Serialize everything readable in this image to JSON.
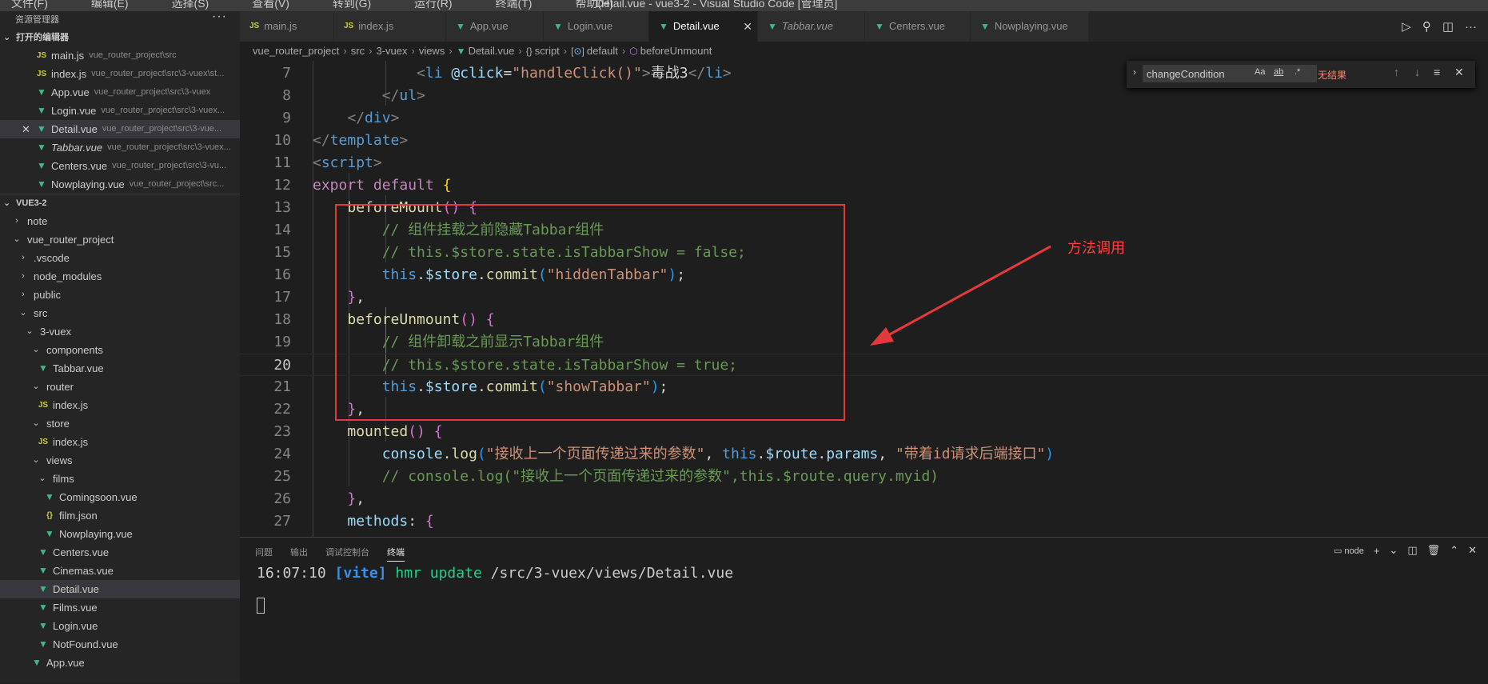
{
  "titlebar": {
    "menus": [
      "文件(F)",
      "编辑(E)",
      "选择(S)",
      "查看(V)",
      "转到(G)",
      "运行(R)",
      "终端(T)",
      "帮助(H)"
    ],
    "window_title": "Detail.vue - vue3-2 - Visual Studio Code [管理员]"
  },
  "sidebar": {
    "header": "资源管理器",
    "more": "···",
    "open_editors_title": "打开的编辑器",
    "open_editors": [
      {
        "icon": "JS",
        "name": "main.js",
        "path": "vue_router_project\\src"
      },
      {
        "icon": "JS",
        "name": "index.js",
        "path": "vue_router_project\\src\\3-vuex\\st..."
      },
      {
        "icon": "▼",
        "name": "App.vue",
        "path": "vue_router_project\\src\\3-vuex"
      },
      {
        "icon": "▼",
        "name": "Login.vue",
        "path": "vue_router_project\\src\\3-vuex..."
      },
      {
        "icon": "▼",
        "name": "Detail.vue",
        "path": "vue_router_project\\src\\3-vue..."
      },
      {
        "icon": "▼",
        "name": "Tabbar.vue",
        "path": "vue_router_project\\src\\3-vuex..."
      },
      {
        "icon": "▼",
        "name": "Centers.vue",
        "path": "vue_router_project\\src\\3-vu..."
      },
      {
        "icon": "▼",
        "name": "Nowplaying.vue",
        "path": "vue_router_project\\src..."
      }
    ],
    "workspace_title": "VUE3-2",
    "tree": [
      {
        "twisty": "›",
        "name": "note"
      },
      {
        "twisty": "⌄",
        "name": "vue_router_project"
      },
      {
        "twisty": "›",
        "name": ".vscode"
      },
      {
        "twisty": "›",
        "name": "node_modules"
      },
      {
        "twisty": "›",
        "name": "public"
      },
      {
        "twisty": "⌄",
        "name": "src"
      },
      {
        "twisty": "⌄",
        "name": "3-vuex"
      },
      {
        "twisty": "⌄",
        "name": "components"
      },
      {
        "icon": "▼",
        "name": "Tabbar.vue"
      },
      {
        "twisty": "⌄",
        "name": "router"
      },
      {
        "icon": "JS",
        "name": "index.js"
      },
      {
        "twisty": "⌄",
        "name": "store"
      },
      {
        "icon": "JS",
        "name": "index.js"
      },
      {
        "twisty": "⌄",
        "name": "views"
      },
      {
        "twisty": "⌄",
        "name": "films"
      },
      {
        "icon": "▼",
        "name": "Comingsoon.vue"
      },
      {
        "icon": "{}",
        "name": "film.json"
      },
      {
        "icon": "▼",
        "name": "Nowplaying.vue"
      },
      {
        "icon": "▼",
        "name": "Centers.vue"
      },
      {
        "icon": "▼",
        "name": "Cinemas.vue"
      },
      {
        "icon": "▼",
        "name": "Detail.vue"
      },
      {
        "icon": "▼",
        "name": "Films.vue"
      },
      {
        "icon": "▼",
        "name": "Login.vue"
      },
      {
        "icon": "▼",
        "name": "NotFound.vue"
      },
      {
        "icon": "▼",
        "name": "App.vue"
      }
    ]
  },
  "tabs": [
    {
      "icon": "JS",
      "label": "main.js"
    },
    {
      "icon": "JS",
      "label": "index.js"
    },
    {
      "icon": "▼",
      "label": "App.vue"
    },
    {
      "icon": "▼",
      "label": "Login.vue"
    },
    {
      "icon": "▼",
      "label": "Detail.vue",
      "close": "✕"
    },
    {
      "icon": "▼",
      "label": "Tabbar.vue"
    },
    {
      "icon": "▼",
      "label": "Centers.vue"
    },
    {
      "icon": "▼",
      "label": "Nowplaying.vue"
    }
  ],
  "tab_actions": [
    "▷",
    "⚲",
    "◫",
    "···"
  ],
  "breadcrumb": {
    "items": [
      "vue_router_project",
      "src",
      "3-vuex",
      "views",
      "Detail.vue",
      "script",
      "default",
      "beforeUnmount"
    ],
    "icons": {
      "file": "▼",
      "script": "{}",
      "default": "[⊙]",
      "method": "⬡"
    }
  },
  "find": {
    "toggle": "›",
    "value": "changeCondition",
    "options": [
      "Aa",
      "ab",
      ".*"
    ],
    "result": "无结果",
    "nav": [
      "↑",
      "↓",
      "≡",
      "✕"
    ]
  },
  "editor": {
    "lines": [
      {
        "n": "7",
        "t": [
          [
            "",
            "            "
          ],
          [
            "c-br",
            "<"
          ],
          [
            "c-tag",
            "li"
          ],
          [
            "c-txt",
            " "
          ],
          [
            "c-attr",
            "@click"
          ],
          [
            "c-txt",
            "="
          ],
          [
            "c-str",
            "\"handleClick()\""
          ],
          [
            "c-br",
            ">"
          ],
          [
            "c-txt",
            "毒战3"
          ],
          [
            "c-br",
            "</"
          ],
          [
            "c-tag",
            "li"
          ],
          [
            "c-br",
            ">"
          ]
        ]
      },
      {
        "n": "8",
        "t": [
          [
            "",
            "        "
          ],
          [
            "c-br",
            "</"
          ],
          [
            "c-tag",
            "ul"
          ],
          [
            "c-br",
            ">"
          ]
        ]
      },
      {
        "n": "9",
        "t": [
          [
            "",
            "    "
          ],
          [
            "c-br",
            "</"
          ],
          [
            "c-tag",
            "div"
          ],
          [
            "c-br",
            ">"
          ]
        ]
      },
      {
        "n": "10",
        "t": [
          [
            "c-br",
            "</"
          ],
          [
            "c-tag",
            "template"
          ],
          [
            "c-br",
            ">"
          ]
        ]
      },
      {
        "n": "11",
        "t": [
          [
            "c-br",
            "<"
          ],
          [
            "c-tag",
            "script"
          ],
          [
            "c-br",
            ">"
          ]
        ]
      },
      {
        "n": "12",
        "t": [
          [
            "c-kw",
            "export"
          ],
          [
            "c-txt",
            " "
          ],
          [
            "c-kw",
            "default"
          ],
          [
            "c-txt",
            " "
          ],
          [
            "c-b1",
            "{"
          ]
        ]
      },
      {
        "n": "13",
        "t": [
          [
            "",
            "    "
          ],
          [
            "c-fn",
            "beforeMount"
          ],
          [
            "c-b2",
            "()"
          ],
          [
            "c-txt",
            " "
          ],
          [
            "c-b2",
            "{"
          ]
        ]
      },
      {
        "n": "14",
        "t": [
          [
            "",
            "        "
          ],
          [
            "c-cm",
            "// 组件挂载之前隐藏Tabbar组件"
          ]
        ]
      },
      {
        "n": "15",
        "t": [
          [
            "",
            "        "
          ],
          [
            "c-cm",
            "// this.$store.state.isTabbarShow = false;"
          ]
        ]
      },
      {
        "n": "16",
        "t": [
          [
            "",
            "        "
          ],
          [
            "c-this",
            "this"
          ],
          [
            "c-txt",
            "."
          ],
          [
            "c-var",
            "$store"
          ],
          [
            "c-txt",
            "."
          ],
          [
            "c-fn",
            "commit"
          ],
          [
            "c-b3",
            "("
          ],
          [
            "c-str",
            "\"hiddenTabbar\""
          ],
          [
            "c-b3",
            ")"
          ],
          [
            "c-txt",
            ";"
          ]
        ]
      },
      {
        "n": "17",
        "t": [
          [
            "",
            "    "
          ],
          [
            "c-b2",
            "}"
          ],
          [
            "c-txt",
            ","
          ]
        ]
      },
      {
        "n": "18",
        "t": [
          [
            "",
            "    "
          ],
          [
            "c-fn",
            "beforeUnmount"
          ],
          [
            "c-b2",
            "()"
          ],
          [
            "c-txt",
            " "
          ],
          [
            "c-b2",
            "{"
          ]
        ]
      },
      {
        "n": "19",
        "t": [
          [
            "",
            "        "
          ],
          [
            "c-cm",
            "// 组件卸载之前显示Tabbar组件"
          ]
        ]
      },
      {
        "n": "20",
        "t": [
          [
            "",
            "        "
          ],
          [
            "c-cm",
            "// this.$store.state.isTabbarShow = true;"
          ]
        ],
        "current": true
      },
      {
        "n": "21",
        "t": [
          [
            "",
            "        "
          ],
          [
            "c-this",
            "this"
          ],
          [
            "c-txt",
            "."
          ],
          [
            "c-var",
            "$store"
          ],
          [
            "c-txt",
            "."
          ],
          [
            "c-fn",
            "commit"
          ],
          [
            "c-b3",
            "("
          ],
          [
            "c-str",
            "\"showTabbar\""
          ],
          [
            "c-b3",
            ")"
          ],
          [
            "c-txt",
            ";"
          ]
        ]
      },
      {
        "n": "22",
        "t": [
          [
            "",
            "    "
          ],
          [
            "c-b2",
            "}"
          ],
          [
            "c-txt",
            ","
          ]
        ]
      },
      {
        "n": "23",
        "t": [
          [
            "",
            "    "
          ],
          [
            "c-fn",
            "mounted"
          ],
          [
            "c-b2",
            "()"
          ],
          [
            "c-txt",
            " "
          ],
          [
            "c-b2",
            "{"
          ]
        ]
      },
      {
        "n": "24",
        "t": [
          [
            "",
            "        "
          ],
          [
            "c-var",
            "console"
          ],
          [
            "c-txt",
            "."
          ],
          [
            "c-fn",
            "log"
          ],
          [
            "c-b3",
            "("
          ],
          [
            "c-str",
            "\"接收上一个页面传递过来的参数\""
          ],
          [
            "c-txt",
            ", "
          ],
          [
            "c-this",
            "this"
          ],
          [
            "c-txt",
            "."
          ],
          [
            "c-var",
            "$route"
          ],
          [
            "c-txt",
            "."
          ],
          [
            "c-var",
            "params"
          ],
          [
            "c-txt",
            ", "
          ],
          [
            "c-str",
            "\"带着id请求后端接口\""
          ],
          [
            "c-b3",
            ")"
          ]
        ]
      },
      {
        "n": "25",
        "t": [
          [
            "",
            "        "
          ],
          [
            "c-cm",
            "// console.log(\"接收上一个页面传递过来的参数\",this.$route.query.myid)"
          ]
        ]
      },
      {
        "n": "26",
        "t": [
          [
            "",
            "    "
          ],
          [
            "c-b2",
            "}"
          ],
          [
            "c-txt",
            ","
          ]
        ]
      },
      {
        "n": "27",
        "t": [
          [
            "",
            "    "
          ],
          [
            "c-var",
            "methods"
          ],
          [
            "c-txt",
            ": "
          ],
          [
            "c-b2",
            "{"
          ]
        ]
      }
    ]
  },
  "annotation": {
    "label": "方法调用",
    "color": "#e5383b"
  },
  "panel": {
    "tabs": [
      "问题",
      "输出",
      "调试控制台",
      "终端"
    ],
    "active_tab": "终端",
    "terminal_name": "node",
    "actions": [
      "+",
      "⌄",
      "◫",
      "🗑",
      "⌃",
      "✕"
    ],
    "terminal_lines": [
      [
        [
          "t-time",
          "16:07:10 "
        ],
        [
          "t-vite",
          "[vite]"
        ],
        [
          "t-hmr",
          " hmr update "
        ],
        [
          "t-path",
          "/src/3-vuex/views/Detail.vue"
        ]
      ]
    ]
  }
}
